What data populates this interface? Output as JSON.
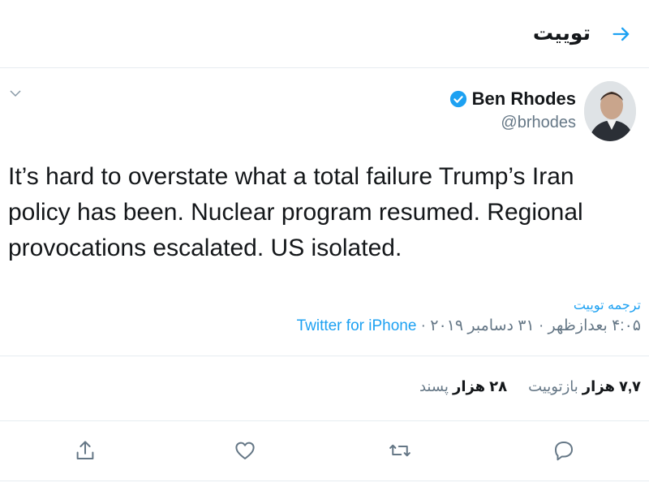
{
  "header": {
    "title": "توییت",
    "back_icon": "arrow-right-icon"
  },
  "author": {
    "display_name": "Ben Rhodes",
    "handle": "@brhodes",
    "verified_icon": "verified-badge-icon",
    "verified_color": "#1da1f2"
  },
  "tweet": {
    "text": "It’s hard to overstate what a total failure Trump’s Iran policy has been. Nuclear program resumed. Regional provocations escalated. US isolated.",
    "translate_label": "ترجمه توییت",
    "timestamp": "۴:۰۵ بعدازظهر · ۳۱ دسامبر ۲۰۱۹ · ",
    "source": "Twitter for iPhone"
  },
  "stats": {
    "retweets": {
      "count": "۷,۷ هزار",
      "label": "بازتوییت"
    },
    "likes": {
      "count": "۲۸ هزار",
      "label": "پسند"
    }
  },
  "actions": [
    "reply-icon",
    "retweet-icon",
    "like-icon",
    "share-icon"
  ],
  "colors": {
    "accent": "#1da1f2",
    "text": "#14171a",
    "muted": "#657786",
    "border": "#e6ecf0"
  }
}
